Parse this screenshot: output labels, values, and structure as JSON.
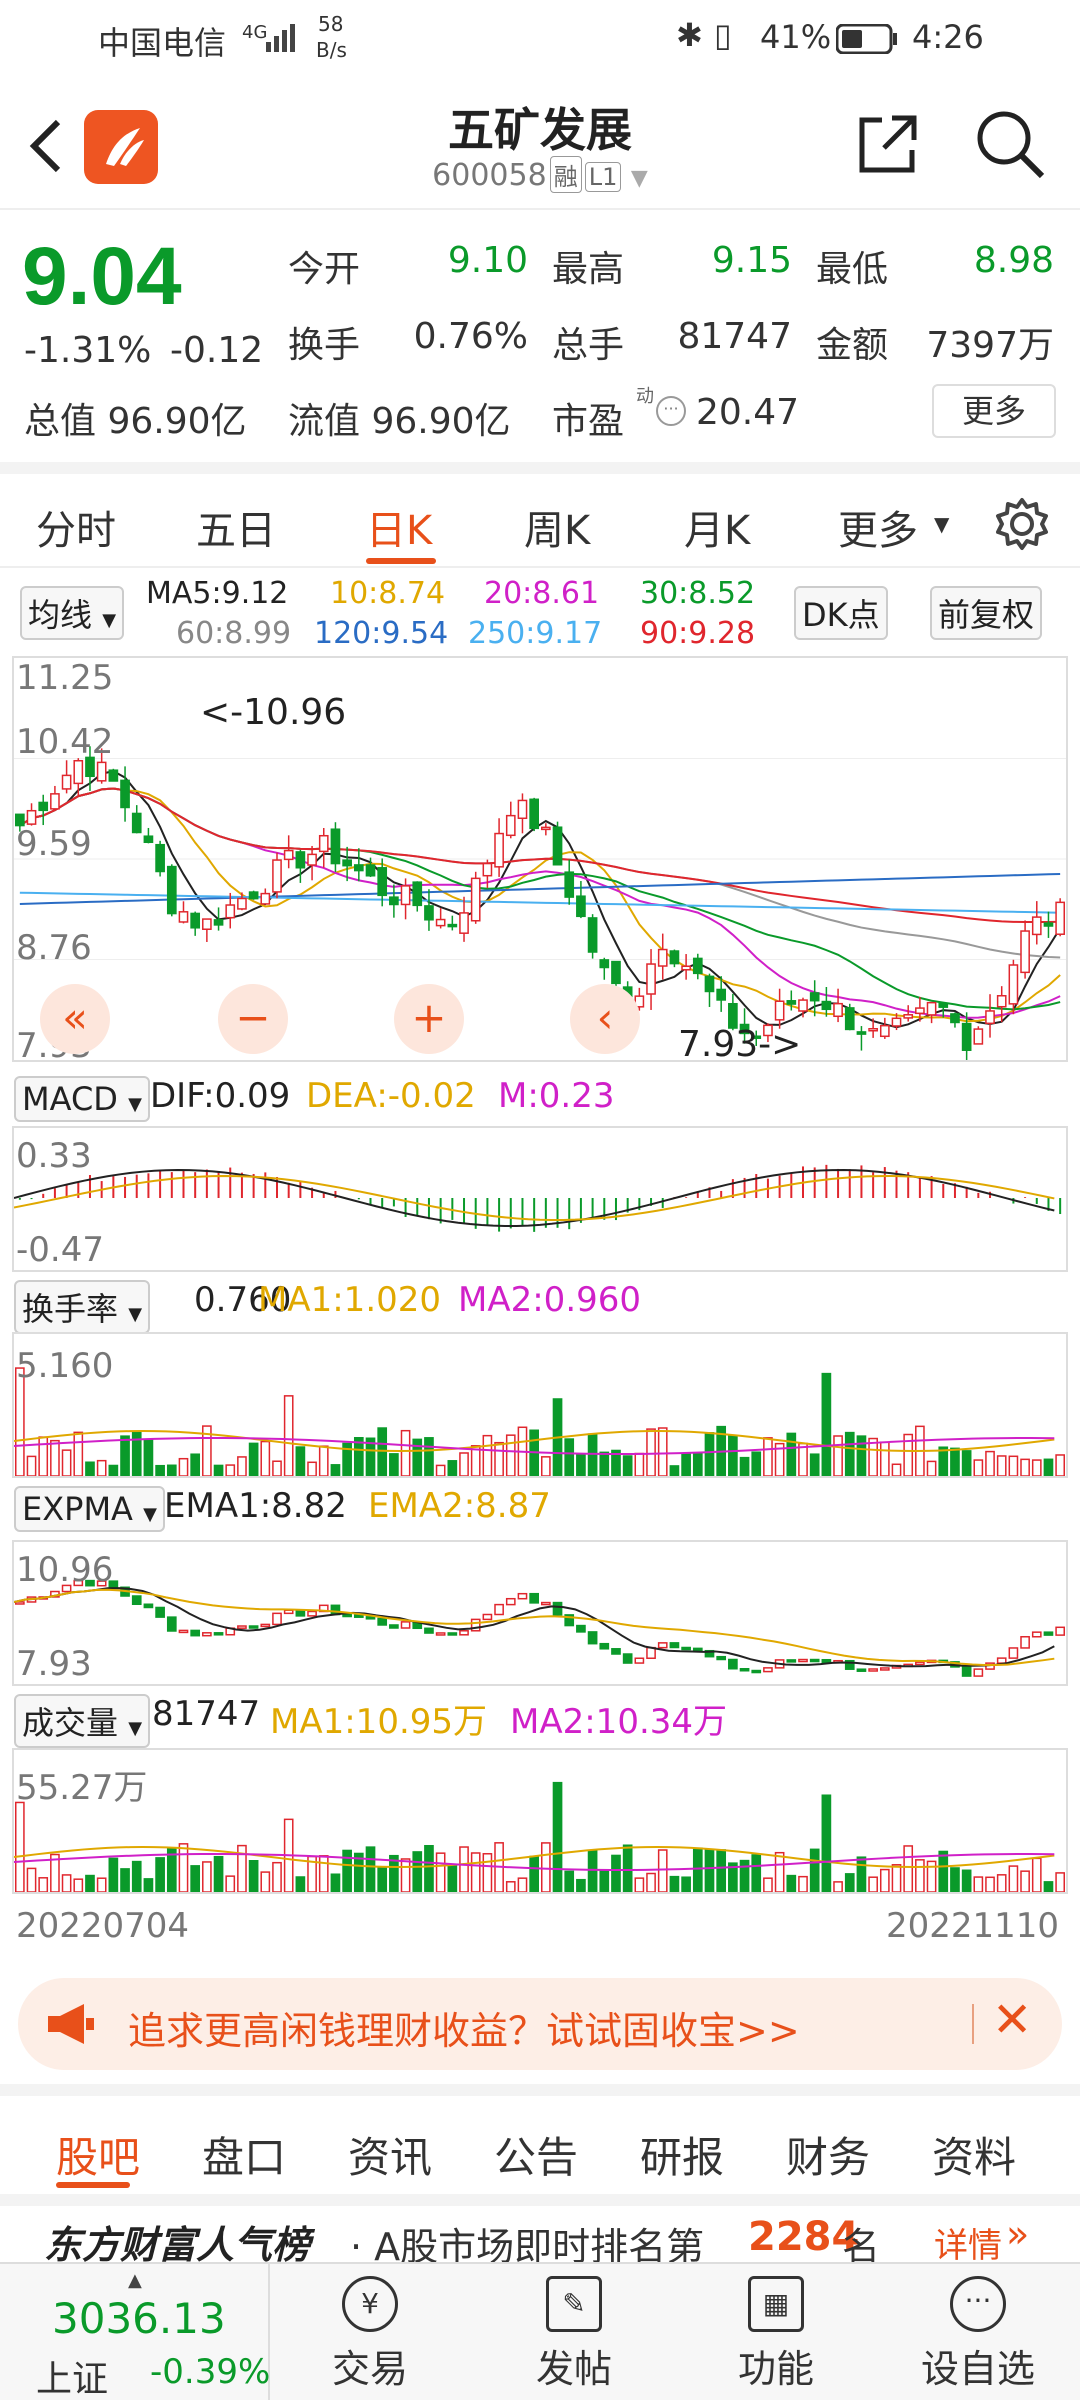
{
  "status": {
    "carrier": "中国电信",
    "signal": "4G",
    "speed_value": "58",
    "speed_unit": "B/s",
    "battery": "41%",
    "time": "4:26"
  },
  "header": {
    "title": "五矿发展",
    "code": "600058",
    "tag1": "融",
    "tag2": "L1"
  },
  "quote": {
    "price": "9.04",
    "change_pct": "-1.31%",
    "change": "-0.12",
    "open_label": "今开",
    "open": "9.10",
    "high_label": "最高",
    "high": "9.15",
    "low_label": "最低",
    "low": "8.98",
    "turnover_label": "换手",
    "turnover": "0.76%",
    "volume_label": "总手",
    "volume": "81747",
    "amount_label": "金额",
    "amount": "7397万",
    "total_value": "总值 96.90亿",
    "float_value": "流值 96.90亿",
    "pe_label": "市盈",
    "pe_sup": "动",
    "pe": "20.47",
    "more": "更多"
  },
  "kline_tabs": [
    "分时",
    "五日",
    "日K",
    "周K",
    "月K",
    "更多"
  ],
  "ma": {
    "select": "均线",
    "ma5": "MA5:9.12",
    "ma10": "10:8.74",
    "ma20": "20:8.61",
    "ma30": "30:8.52",
    "ma60": "60:8.99",
    "ma120": "120:9.54",
    "ma250": "250:9.17",
    "ma90": "90:9.28",
    "dk": "DK点",
    "fq": "前复权"
  },
  "main_chart": {
    "y_labels": [
      "11.25",
      "10.42",
      "9.59",
      "8.76",
      "7.93"
    ],
    "high_annot": "<-10.96",
    "low_annot": "7.93->",
    "btn_left": "«",
    "btn_minus": "−",
    "btn_plus": "+",
    "btn_back": "‹"
  },
  "macd": {
    "select": "MACD",
    "dif": "DIF:0.09",
    "dea": "DEA:-0.02",
    "m": "M:0.23",
    "ymax": "0.33",
    "ymin": "-0.47"
  },
  "hsl": {
    "select": "换手率",
    "val": "0.760",
    "ma1": "MA1:1.020",
    "ma2": "MA2:0.960",
    "ymax": "5.160"
  },
  "expma": {
    "select": "EXPMA",
    "ema1": "EMA1:8.82",
    "ema2": "EMA2:8.87",
    "ymax": "10.96",
    "ymin": "7.93"
  },
  "vol": {
    "select": "成交量",
    "val": "81747",
    "ma1": "MA1:10.95万",
    "ma2": "MA2:10.34万",
    "ymax": "55.27万"
  },
  "dates": {
    "start": "20220704",
    "end": "20221110"
  },
  "banner": {
    "text": "追求更高闲钱理财收益？试试固收宝>>"
  },
  "bottom_tabs": [
    "股吧",
    "盘口",
    "资讯",
    "公告",
    "研报",
    "财务",
    "资料"
  ],
  "rank": {
    "brand": "东方财富人气榜",
    "text_before": "· A股市场即时排名第",
    "rank": "2284",
    "text_after": "名",
    "detail": "详情"
  },
  "nav": {
    "index_value": "3036.13",
    "index_name": "上证",
    "index_change": "-0.39%",
    "items": [
      "交易",
      "发帖",
      "功能",
      "设自选"
    ]
  },
  "colors": {
    "up": "#e0262d",
    "down": "#0a9a2a",
    "accent": "#e8501a"
  }
}
